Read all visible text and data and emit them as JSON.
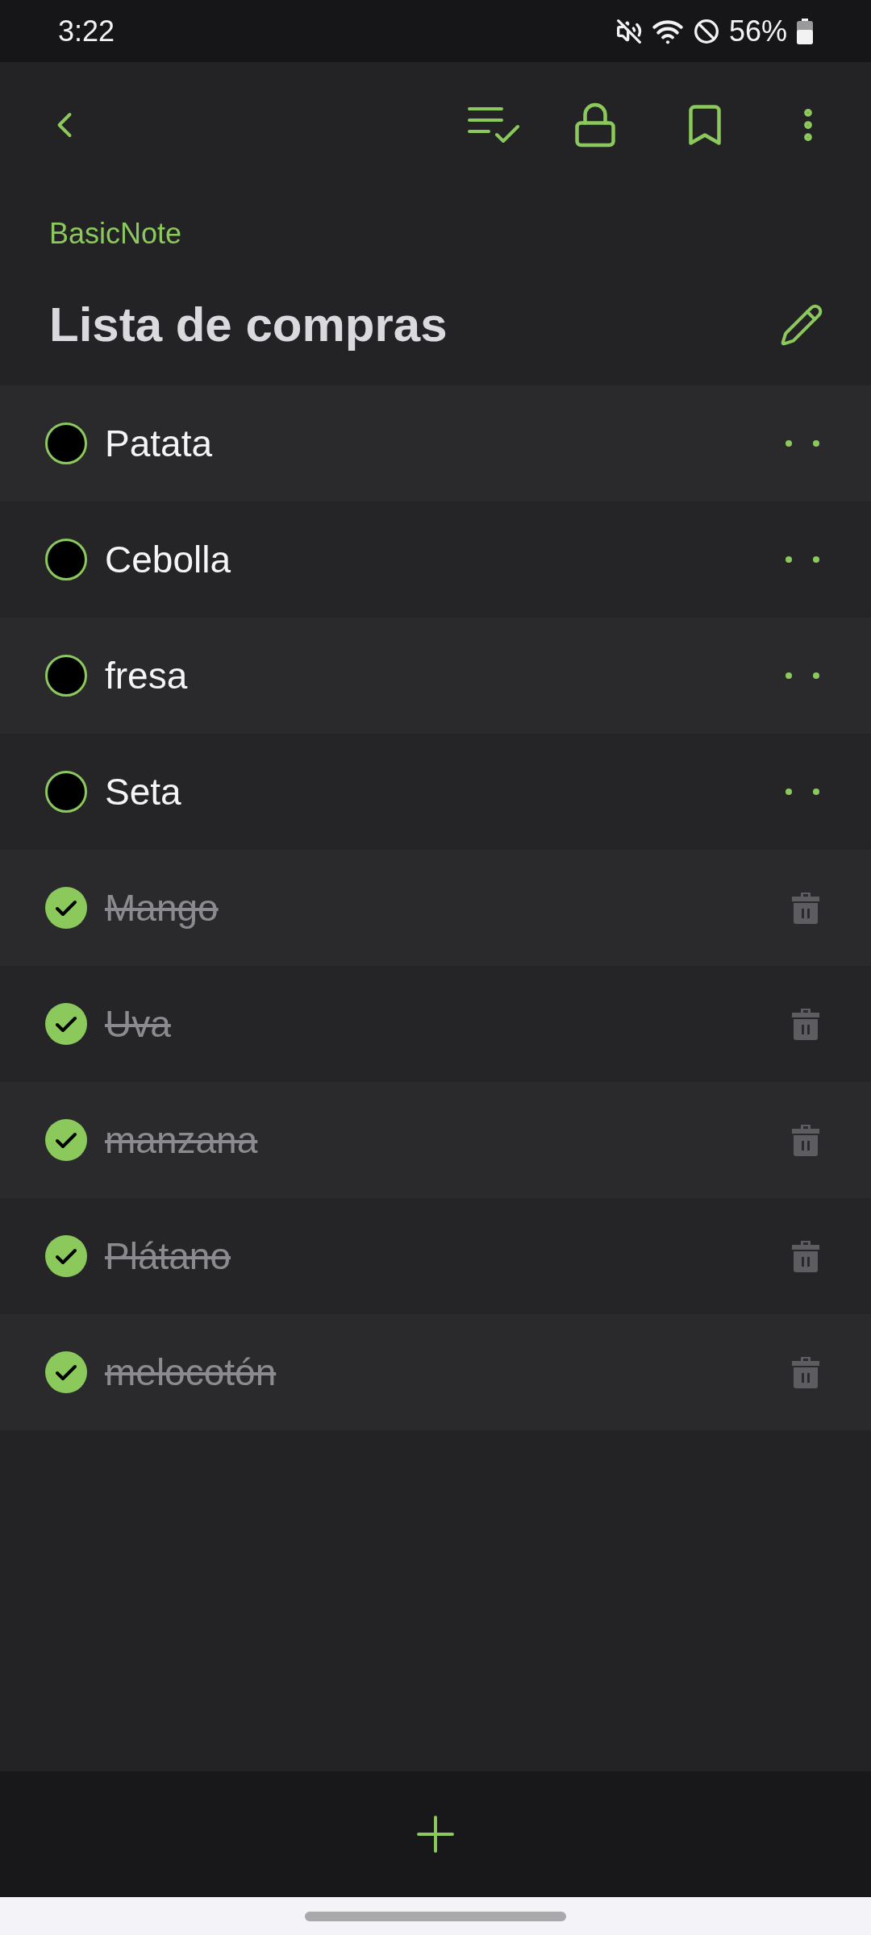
{
  "status_bar": {
    "time": "3:22",
    "battery": "56%"
  },
  "app_name": "BasicNote",
  "note": {
    "title": "Lista de compras"
  },
  "items": [
    {
      "text": "Patata",
      "checked": false
    },
    {
      "text": "Cebolla",
      "checked": false
    },
    {
      "text": "fresa",
      "checked": false
    },
    {
      "text": "Seta",
      "checked": false
    },
    {
      "text": "Mango",
      "checked": true
    },
    {
      "text": "Uva",
      "checked": true
    },
    {
      "text": "manzana",
      "checked": true
    },
    {
      "text": "Plátano",
      "checked": true
    },
    {
      "text": "melocotón",
      "checked": true
    }
  ]
}
